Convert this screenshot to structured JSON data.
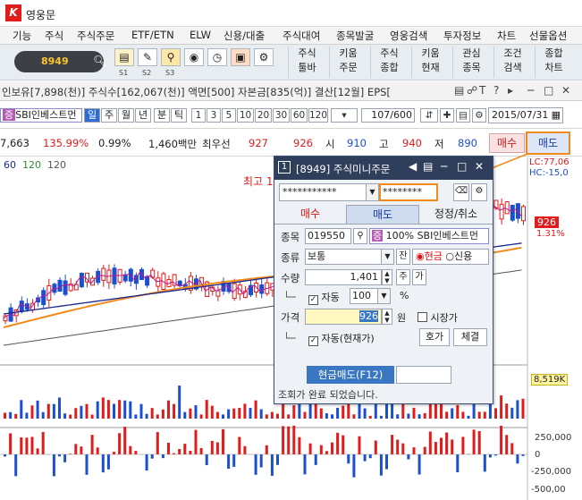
{
  "app": {
    "title": "영웅문"
  },
  "menu": [
    "기능",
    "주식",
    "주식주문",
    "ETF/ETN",
    "ELW",
    "신용/대출",
    "주식대여",
    "종목발굴",
    "영웅검색",
    "투자정보",
    "차트",
    "선물옵션"
  ],
  "toolbar": {
    "code": "8949",
    "small_icon_labels": [
      "S1",
      "S2",
      "S3"
    ],
    "buttons": [
      "주식\n툴바",
      "키움\n주문",
      "주식\n종합",
      "키움\n현재",
      "관심\n종목",
      "조건\n검색",
      "종합\n차트"
    ]
  },
  "chart_window": {
    "title": "인보유[7,898(천)] 주식수[162,067(천)] 액면[500] 자본금[835(억)] 결산[12월] EPS[",
    "stock_code_chip": "증",
    "stock_name": "SBI인베스트먼",
    "periods": [
      "일",
      "주",
      "월",
      "년",
      "분",
      "틱"
    ],
    "minutes": [
      "1",
      "3",
      "5",
      "10",
      "20",
      "30",
      "60",
      "120"
    ],
    "count": "107/600",
    "date": "2015/07/31"
  },
  "info_row": {
    "volume": "7,663",
    "volume_ratio": "135.99%",
    "turnover": "0.99%",
    "amount": "1,460백만",
    "best_label": "최우선",
    "ask": "927",
    "bid": "926",
    "open_label": "시",
    "open": "910",
    "high_label": "고",
    "high": "940",
    "low_label": "저",
    "low": "890",
    "buy": "매수",
    "sell": "매도"
  },
  "chart": {
    "ma_legend": [
      "60",
      "120",
      "120"
    ],
    "max_label": "최고 1",
    "lc": "LC:77,06",
    "hc": "HC:-15,0",
    "price": "926",
    "change": "1.31%",
    "volume_tag": "8,519K",
    "osc_ticks": [
      "250,000",
      "0",
      "-250,000",
      "-500,00"
    ],
    "colors": {
      "up": "#e21b1b",
      "down": "#1a4fd0",
      "ma_orange": "#f28a1c",
      "ma_navy": "#1c2a8c"
    }
  },
  "dialog": {
    "number": "1",
    "title": "[8949] 주식미니주문",
    "account": "***********",
    "password": "********",
    "tabs": [
      "매수",
      "매도",
      "정정/취소"
    ],
    "stock_label": "종목",
    "stock_code": "019550",
    "stock_chip": "증",
    "stock_pct": "100%",
    "stock_name": "SBI인베스트먼",
    "type_label": "종류",
    "type_value": "보통",
    "balance_btn": "잔",
    "radio_cash": "현금",
    "radio_credit": "신용",
    "qty_label": "수량",
    "qty": "1,401",
    "qty_btn1": "주",
    "qty_btn2": "가",
    "auto_label": "자동",
    "auto_value": "100",
    "auto_unit": "%",
    "price_label": "가격",
    "price": "926",
    "price_unit": "원",
    "market_label": "시장가",
    "auto_price_label": "자동(현재가)",
    "quote_btn": "호가",
    "fill_btn": "체결",
    "submit": "현금매도(F12)",
    "status": "조회가 완료 되었습니다."
  }
}
